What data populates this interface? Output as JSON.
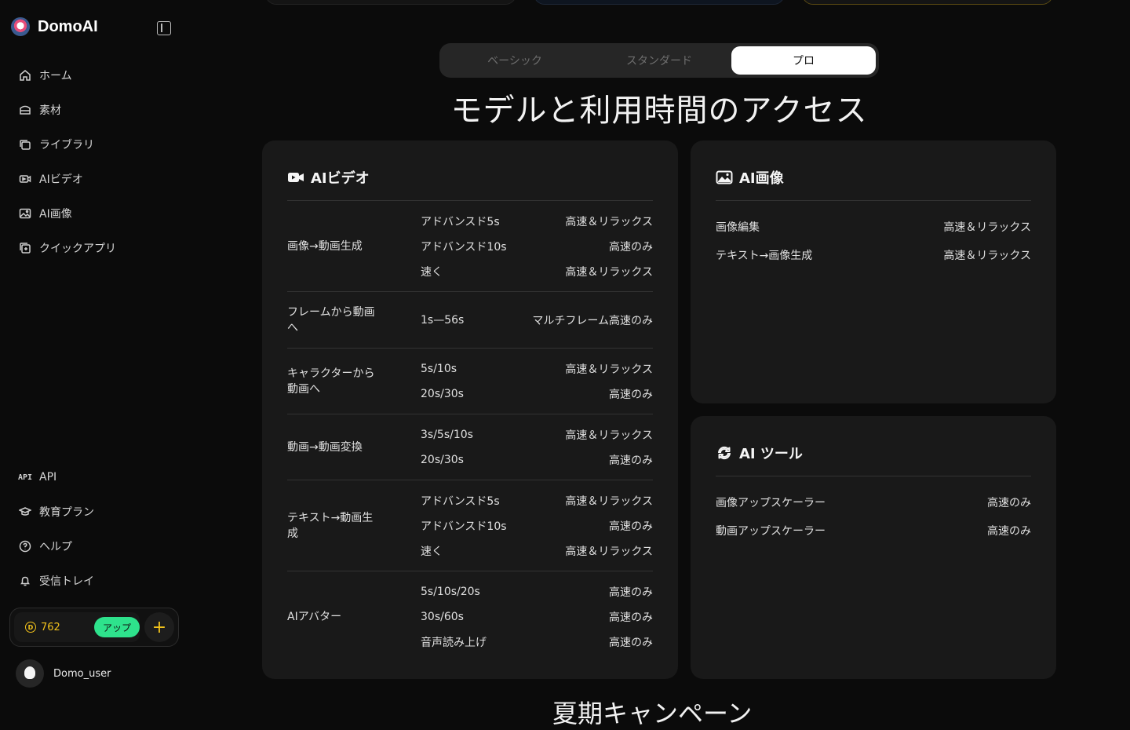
{
  "app": {
    "name": "DomoAI"
  },
  "sidebar": {
    "items": [
      {
        "label": "ホーム",
        "icon": "home-icon"
      },
      {
        "label": "素材",
        "icon": "assets-icon"
      },
      {
        "label": "ライブラリ",
        "icon": "library-icon"
      },
      {
        "label": "AIビデオ",
        "icon": "video-icon"
      },
      {
        "label": "AI画像",
        "icon": "image-icon"
      },
      {
        "label": "クイックアプリ",
        "icon": "quick-app-icon"
      }
    ],
    "bottom_items": [
      {
        "label": "API",
        "icon": "api-icon"
      },
      {
        "label": "教育プラン",
        "icon": "graduation-cap-icon"
      },
      {
        "label": "ヘルプ",
        "icon": "help-icon"
      },
      {
        "label": "受信トレイ",
        "icon": "bell-icon"
      }
    ],
    "credits": {
      "count": "762",
      "upgrade_label": "アップ"
    },
    "user": {
      "name": "Domo_user"
    }
  },
  "plan_tabs": {
    "items": [
      "ベーシック",
      "スタンダード",
      "プロ"
    ],
    "active": "プロ"
  },
  "section_title": "モデルと利用時間のアクセス",
  "video_card": {
    "title": "AIビデオ",
    "groups": [
      {
        "label": "画像→動画生成",
        "rows": [
          [
            "アドバンスド5s",
            "高速＆リラックス"
          ],
          [
            "アドバンスド10s",
            "高速のみ"
          ],
          [
            "速く",
            "高速＆リラックス"
          ]
        ]
      },
      {
        "label": "フレームから動画へ",
        "rows": [
          [
            "1s—56s",
            "マルチフレーム高速のみ"
          ]
        ]
      },
      {
        "label": "キャラクターから動画へ",
        "rows": [
          [
            "5s/10s",
            "高速＆リラックス"
          ],
          [
            "20s/30s",
            "高速のみ"
          ]
        ]
      },
      {
        "label": "動画→動画変換",
        "rows": [
          [
            "3s/5s/10s",
            "高速＆リラックス"
          ],
          [
            "20s/30s",
            "高速のみ"
          ]
        ]
      },
      {
        "label": "テキスト→動画生成",
        "rows": [
          [
            "アドバンスド5s",
            "高速＆リラックス"
          ],
          [
            "アドバンスド10s",
            "高速のみ"
          ],
          [
            "速く",
            "高速＆リラックス"
          ]
        ]
      },
      {
        "label": "AIアバター",
        "rows": [
          [
            "5s/10s/20s",
            "高速のみ"
          ],
          [
            "30s/60s",
            "高速のみ"
          ],
          [
            "音声読み上げ",
            "高速のみ"
          ]
        ]
      }
    ]
  },
  "image_card": {
    "title": "AI画像",
    "rows": [
      [
        "画像編集",
        "高速＆リラックス"
      ],
      [
        "テキスト→画像生成",
        "高速＆リラックス"
      ]
    ]
  },
  "tools_card": {
    "title": "AI ツール",
    "rows": [
      [
        "画像アップスケーラー",
        "高速のみ"
      ],
      [
        "動画アップスケーラー",
        "高速のみ"
      ]
    ]
  },
  "next_section_title": "夏期キャンペーン"
}
